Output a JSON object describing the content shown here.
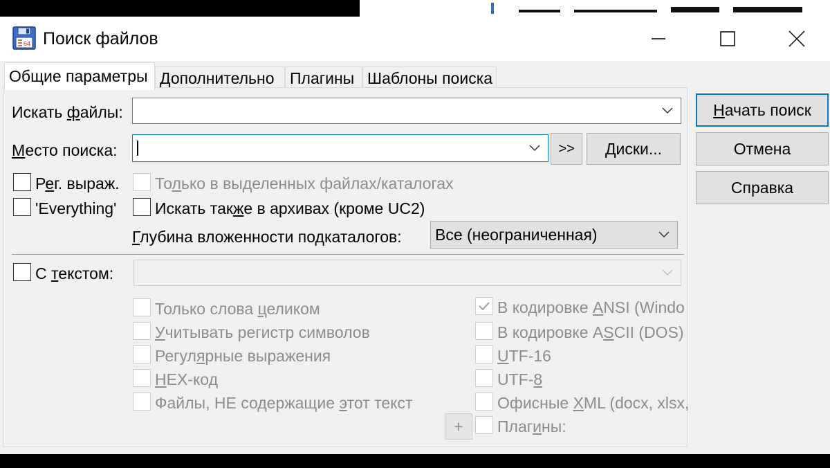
{
  "window": {
    "title": "Поиск файлов",
    "icon": "floppy-disk-icon"
  },
  "tabs": [
    {
      "label": "Общие параметры",
      "active": true
    },
    {
      "label": "Дополнительно"
    },
    {
      "label": "Плагины"
    },
    {
      "label": "Шаблоны поиска"
    }
  ],
  "search": {
    "files_label_pre": "Искать ",
    "files_label_ul": "ф",
    "files_label_post": "айлы:",
    "files_value": "",
    "location_label_pre": "",
    "location_label_ul": "М",
    "location_label_post": "есто поиска:",
    "location_value": "",
    "arrows_button": ">>",
    "drives_button": "Диски..."
  },
  "options": {
    "regex_pre": "Р",
    "regex_ul": "е",
    "regex_post": "г. выраж.",
    "everything": "'Everything'",
    "selected_only_pre": "То",
    "selected_only_ul": "л",
    "selected_only_post": "ько в выделенных файлах/каталогах",
    "archives_pre": "Искать так",
    "archives_ul": "ж",
    "archives_post": "е в архивах (кроме UC2)",
    "depth_label_pre": "",
    "depth_label_ul": "Г",
    "depth_label_post": "лубина вложенности подкаталогов:",
    "depth_value": "Все (неограниченная)"
  },
  "text_search": {
    "label_pre": "С ",
    "label_ul": "т",
    "label_post": "екстом:",
    "value": "",
    "left": [
      {
        "pre": "Только слова ",
        "ul": "ц",
        "post": "еликом"
      },
      {
        "pre": "",
        "ul": "У",
        "post": "читывать регистр символов"
      },
      {
        "pre": "Регул",
        "ul": "я",
        "post": "рные выражения"
      },
      {
        "pre": "",
        "ul": "Н",
        "post": "EX-код"
      },
      {
        "pre": "Файлы, НЕ содержащие ",
        "ul": "э",
        "post": "тот текст"
      }
    ],
    "right": [
      {
        "pre": "В кодировке ",
        "ul": "A",
        "post": "NSI (Windo",
        "checked": true
      },
      {
        "pre": "В кодировке A",
        "ul": "S",
        "post": "CII (DOS)"
      },
      {
        "pre": "",
        "ul": "U",
        "post": "TF-16"
      },
      {
        "pre": "UTF-",
        "ul": "8",
        "post": ""
      },
      {
        "pre": "Офисные ",
        "ul": "X",
        "post": "ML (docx, xlsx,"
      },
      {
        "pre": "Плаг",
        "ul": "и",
        "post": "ны:"
      }
    ],
    "plus_button": "+"
  },
  "buttons": {
    "start_pre": "",
    "start_ul": "Н",
    "start_post": "ачать поиск",
    "cancel": "Отмена",
    "help": "Справка"
  },
  "colors": {
    "focus_border": "#0078d7",
    "dialog_bg": "#f0f0f0",
    "disabled_text": "#8c8c8c"
  }
}
